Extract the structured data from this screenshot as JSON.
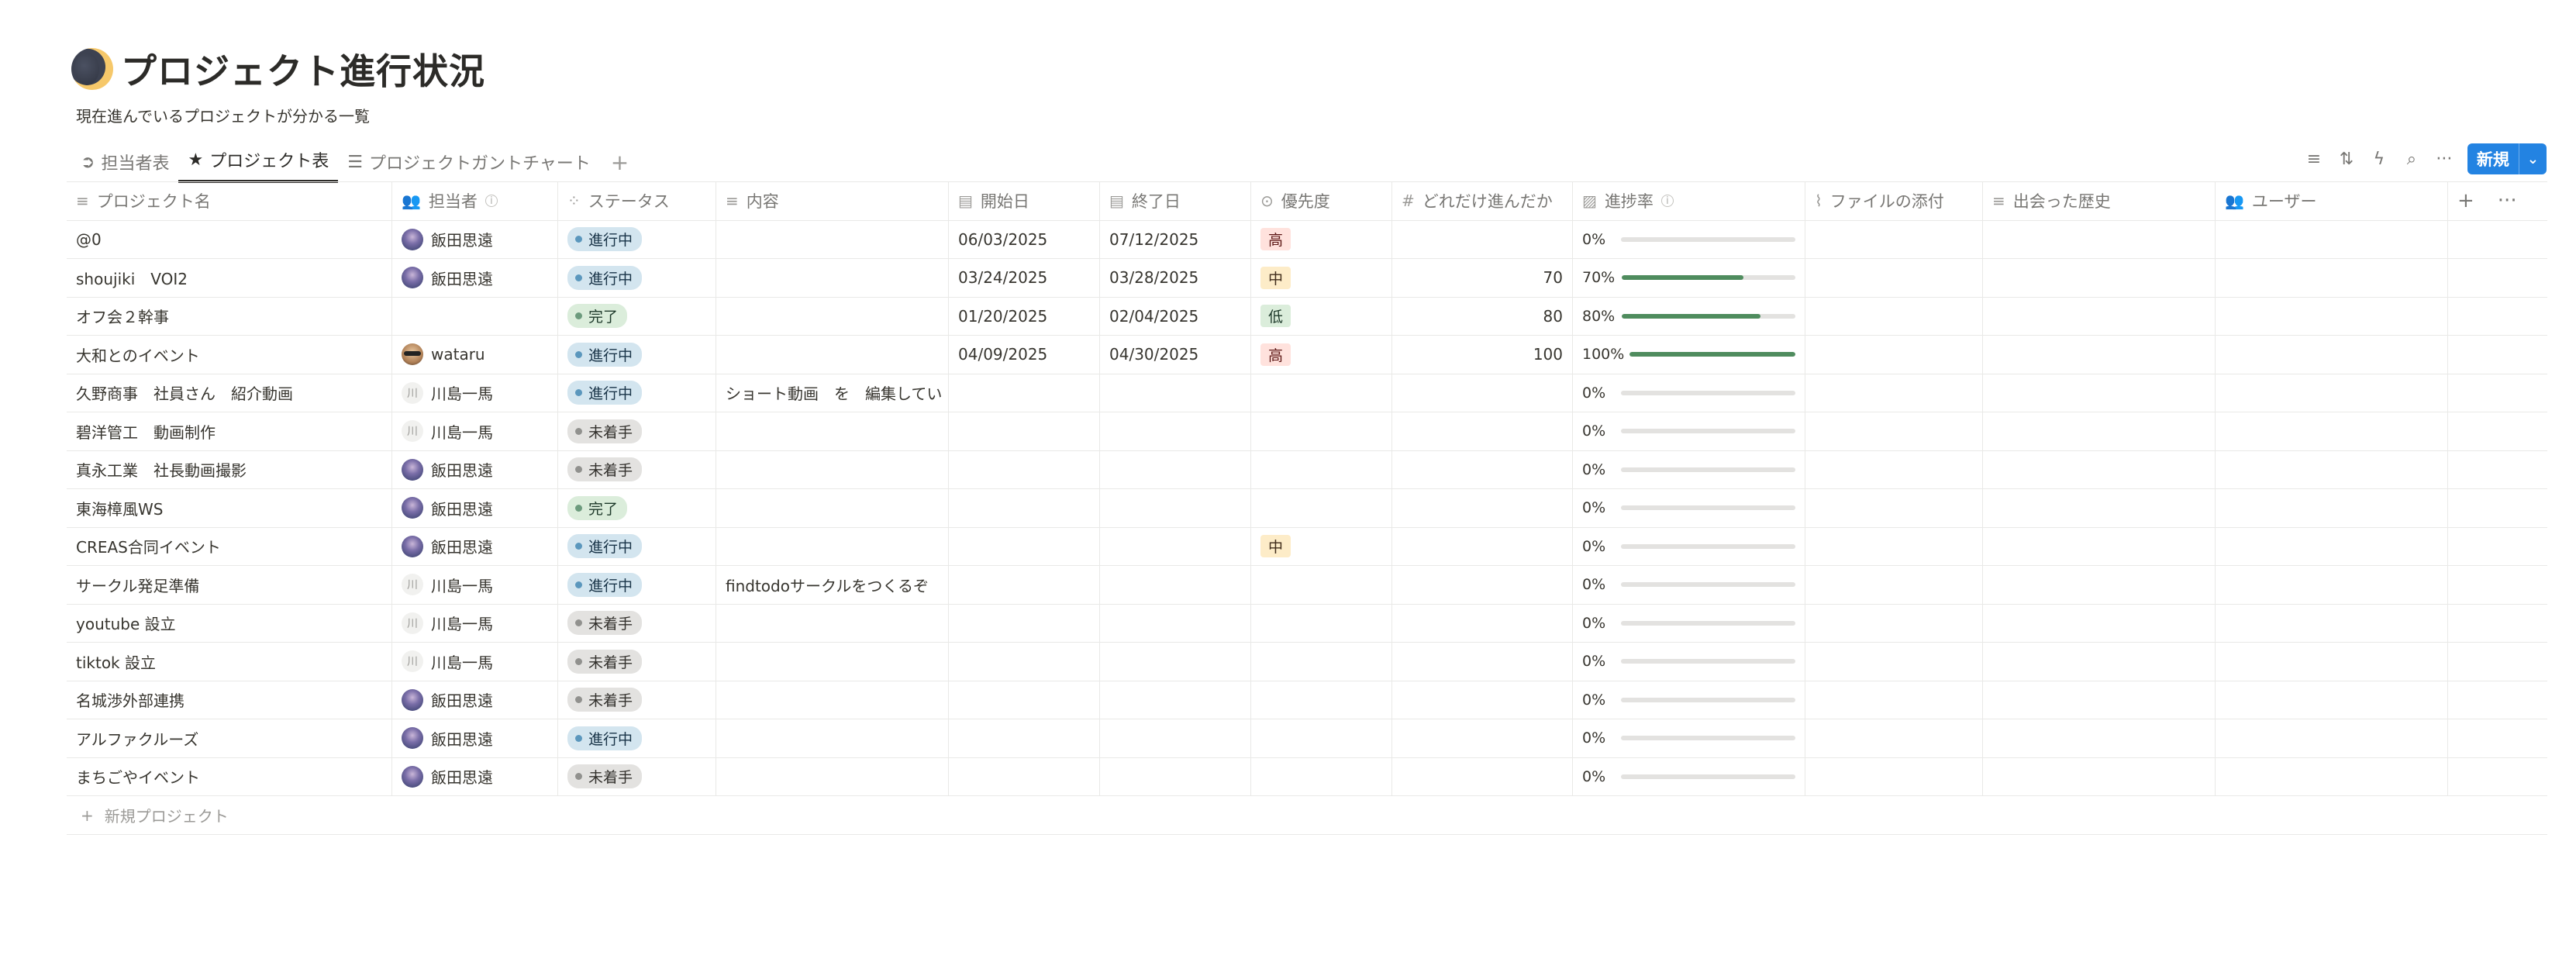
{
  "page": {
    "title": "プロジェクト進行状況",
    "description": "現在進んでいるプロジェクトが分かる一覧",
    "icon": "moon-icon"
  },
  "tabs": [
    {
      "label": "担当者表",
      "icon": "arrow-circle-icon",
      "active": false
    },
    {
      "label": "プロジェクト表",
      "icon": "star-icon",
      "active": true
    },
    {
      "label": "プロジェクトガントチャート",
      "icon": "gantt-icon",
      "active": false
    }
  ],
  "toolbar": {
    "new_label": "新規",
    "icons": [
      "filter-icon",
      "sort-icon",
      "lightning-icon",
      "search-icon",
      "more-icon"
    ]
  },
  "columns": [
    {
      "label": "プロジェクト名",
      "icon": "title-icon"
    },
    {
      "label": "担当者",
      "icon": "people-icon",
      "info": true
    },
    {
      "label": "ステータス",
      "icon": "status-icon"
    },
    {
      "label": "内容",
      "icon": "text-icon"
    },
    {
      "label": "開始日",
      "icon": "calendar-icon"
    },
    {
      "label": "終了日",
      "icon": "calendar-icon"
    },
    {
      "label": "優先度",
      "icon": "select-icon"
    },
    {
      "label": "どれだけ進んだか",
      "icon": "number-icon"
    },
    {
      "label": "進捗率",
      "icon": "formula-icon",
      "info": true
    },
    {
      "label": "ファイルの添付",
      "icon": "paperclip-icon"
    },
    {
      "label": "出会った歴史",
      "icon": "text-icon"
    },
    {
      "label": "ユーザー",
      "icon": "people-icon"
    }
  ],
  "rows": [
    {
      "name": "@0",
      "owner": "飯田思遠",
      "avatar": "photo",
      "status": "進行中",
      "status_kind": "prog",
      "content": "",
      "start": "06/03/2025",
      "end": "07/12/2025",
      "priority": "高",
      "priority_kind": "high",
      "amount": "",
      "progress": 0,
      "progress_label": "0%"
    },
    {
      "name": "shoujiki　VOI2",
      "owner": "飯田思遠",
      "avatar": "photo",
      "status": "進行中",
      "status_kind": "prog",
      "content": "",
      "start": "03/24/2025",
      "end": "03/28/2025",
      "priority": "中",
      "priority_kind": "mid",
      "amount": "70",
      "progress": 0.7,
      "progress_label": "70%"
    },
    {
      "name": "オフ会２幹事",
      "owner": "",
      "avatar": "",
      "status": "完了",
      "status_kind": "done",
      "content": "",
      "start": "01/20/2025",
      "end": "02/04/2025",
      "priority": "低",
      "priority_kind": "low",
      "amount": "80",
      "progress": 0.8,
      "progress_label": "80%"
    },
    {
      "name": "大和とのイベント",
      "owner": "wataru",
      "avatar": "glasses",
      "status": "進行中",
      "status_kind": "prog",
      "content": "",
      "start": "04/09/2025",
      "end": "04/30/2025",
      "priority": "高",
      "priority_kind": "high",
      "amount": "100",
      "progress": 1.0,
      "progress_label": "100%"
    },
    {
      "name": "久野商事　社員さん　紹介動画",
      "owner": "川島一馬",
      "avatar": "initial",
      "status": "進行中",
      "status_kind": "prog",
      "content": "ショート動画　を　編集してい",
      "start": "",
      "end": "",
      "priority": "",
      "priority_kind": "",
      "amount": "",
      "progress": 0,
      "progress_label": "0%"
    },
    {
      "name": "碧洋管工　動画制作",
      "owner": "川島一馬",
      "avatar": "initial",
      "status": "未着手",
      "status_kind": "none",
      "content": "",
      "start": "",
      "end": "",
      "priority": "",
      "priority_kind": "",
      "amount": "",
      "progress": 0,
      "progress_label": "0%"
    },
    {
      "name": "真永工業　社長動画撮影",
      "owner": "飯田思遠",
      "avatar": "photo",
      "status": "未着手",
      "status_kind": "none",
      "content": "",
      "start": "",
      "end": "",
      "priority": "",
      "priority_kind": "",
      "amount": "",
      "progress": 0,
      "progress_label": "0%"
    },
    {
      "name": "東海樟風WS",
      "owner": "飯田思遠",
      "avatar": "photo",
      "status": "完了",
      "status_kind": "done",
      "content": "",
      "start": "",
      "end": "",
      "priority": "",
      "priority_kind": "",
      "amount": "",
      "progress": 0,
      "progress_label": "0%"
    },
    {
      "name": "CREAS合同イベント",
      "owner": "飯田思遠",
      "avatar": "photo",
      "status": "進行中",
      "status_kind": "prog",
      "content": "",
      "start": "",
      "end": "",
      "priority": "中",
      "priority_kind": "mid",
      "amount": "",
      "progress": 0,
      "progress_label": "0%"
    },
    {
      "name": "サークル発足準備",
      "owner": "川島一馬",
      "avatar": "initial",
      "status": "進行中",
      "status_kind": "prog",
      "content": "findtodoサークルをつくるぞ",
      "start": "",
      "end": "",
      "priority": "",
      "priority_kind": "",
      "amount": "",
      "progress": 0,
      "progress_label": "0%"
    },
    {
      "name": "youtube 設立",
      "owner": "川島一馬",
      "avatar": "initial",
      "status": "未着手",
      "status_kind": "none",
      "content": "",
      "start": "",
      "end": "",
      "priority": "",
      "priority_kind": "",
      "amount": "",
      "progress": 0,
      "progress_label": "0%"
    },
    {
      "name": "tiktok 設立",
      "owner": "川島一馬",
      "avatar": "initial",
      "status": "未着手",
      "status_kind": "none",
      "content": "",
      "start": "",
      "end": "",
      "priority": "",
      "priority_kind": "",
      "amount": "",
      "progress": 0,
      "progress_label": "0%"
    },
    {
      "name": "名城渉外部連携",
      "owner": "飯田思遠",
      "avatar": "photo",
      "status": "未着手",
      "status_kind": "none",
      "content": "",
      "start": "",
      "end": "",
      "priority": "",
      "priority_kind": "",
      "amount": "",
      "progress": 0,
      "progress_label": "0%"
    },
    {
      "name": "アルファクルーズ",
      "owner": "飯田思遠",
      "avatar": "photo",
      "status": "進行中",
      "status_kind": "prog",
      "content": "",
      "start": "",
      "end": "",
      "priority": "",
      "priority_kind": "",
      "amount": "",
      "progress": 0,
      "progress_label": "0%"
    },
    {
      "name": "まちごやイベント",
      "owner": "飯田思遠",
      "avatar": "photo",
      "status": "未着手",
      "status_kind": "none",
      "content": "",
      "start": "",
      "end": "",
      "priority": "",
      "priority_kind": "",
      "amount": "",
      "progress": 0,
      "progress_label": "0%"
    }
  ],
  "add_row_label": "新規プロジェクト",
  "avatar_initial": "川",
  "colors": {
    "accent": "#2383e2",
    "progress_bar": "#4f8c5e"
  }
}
